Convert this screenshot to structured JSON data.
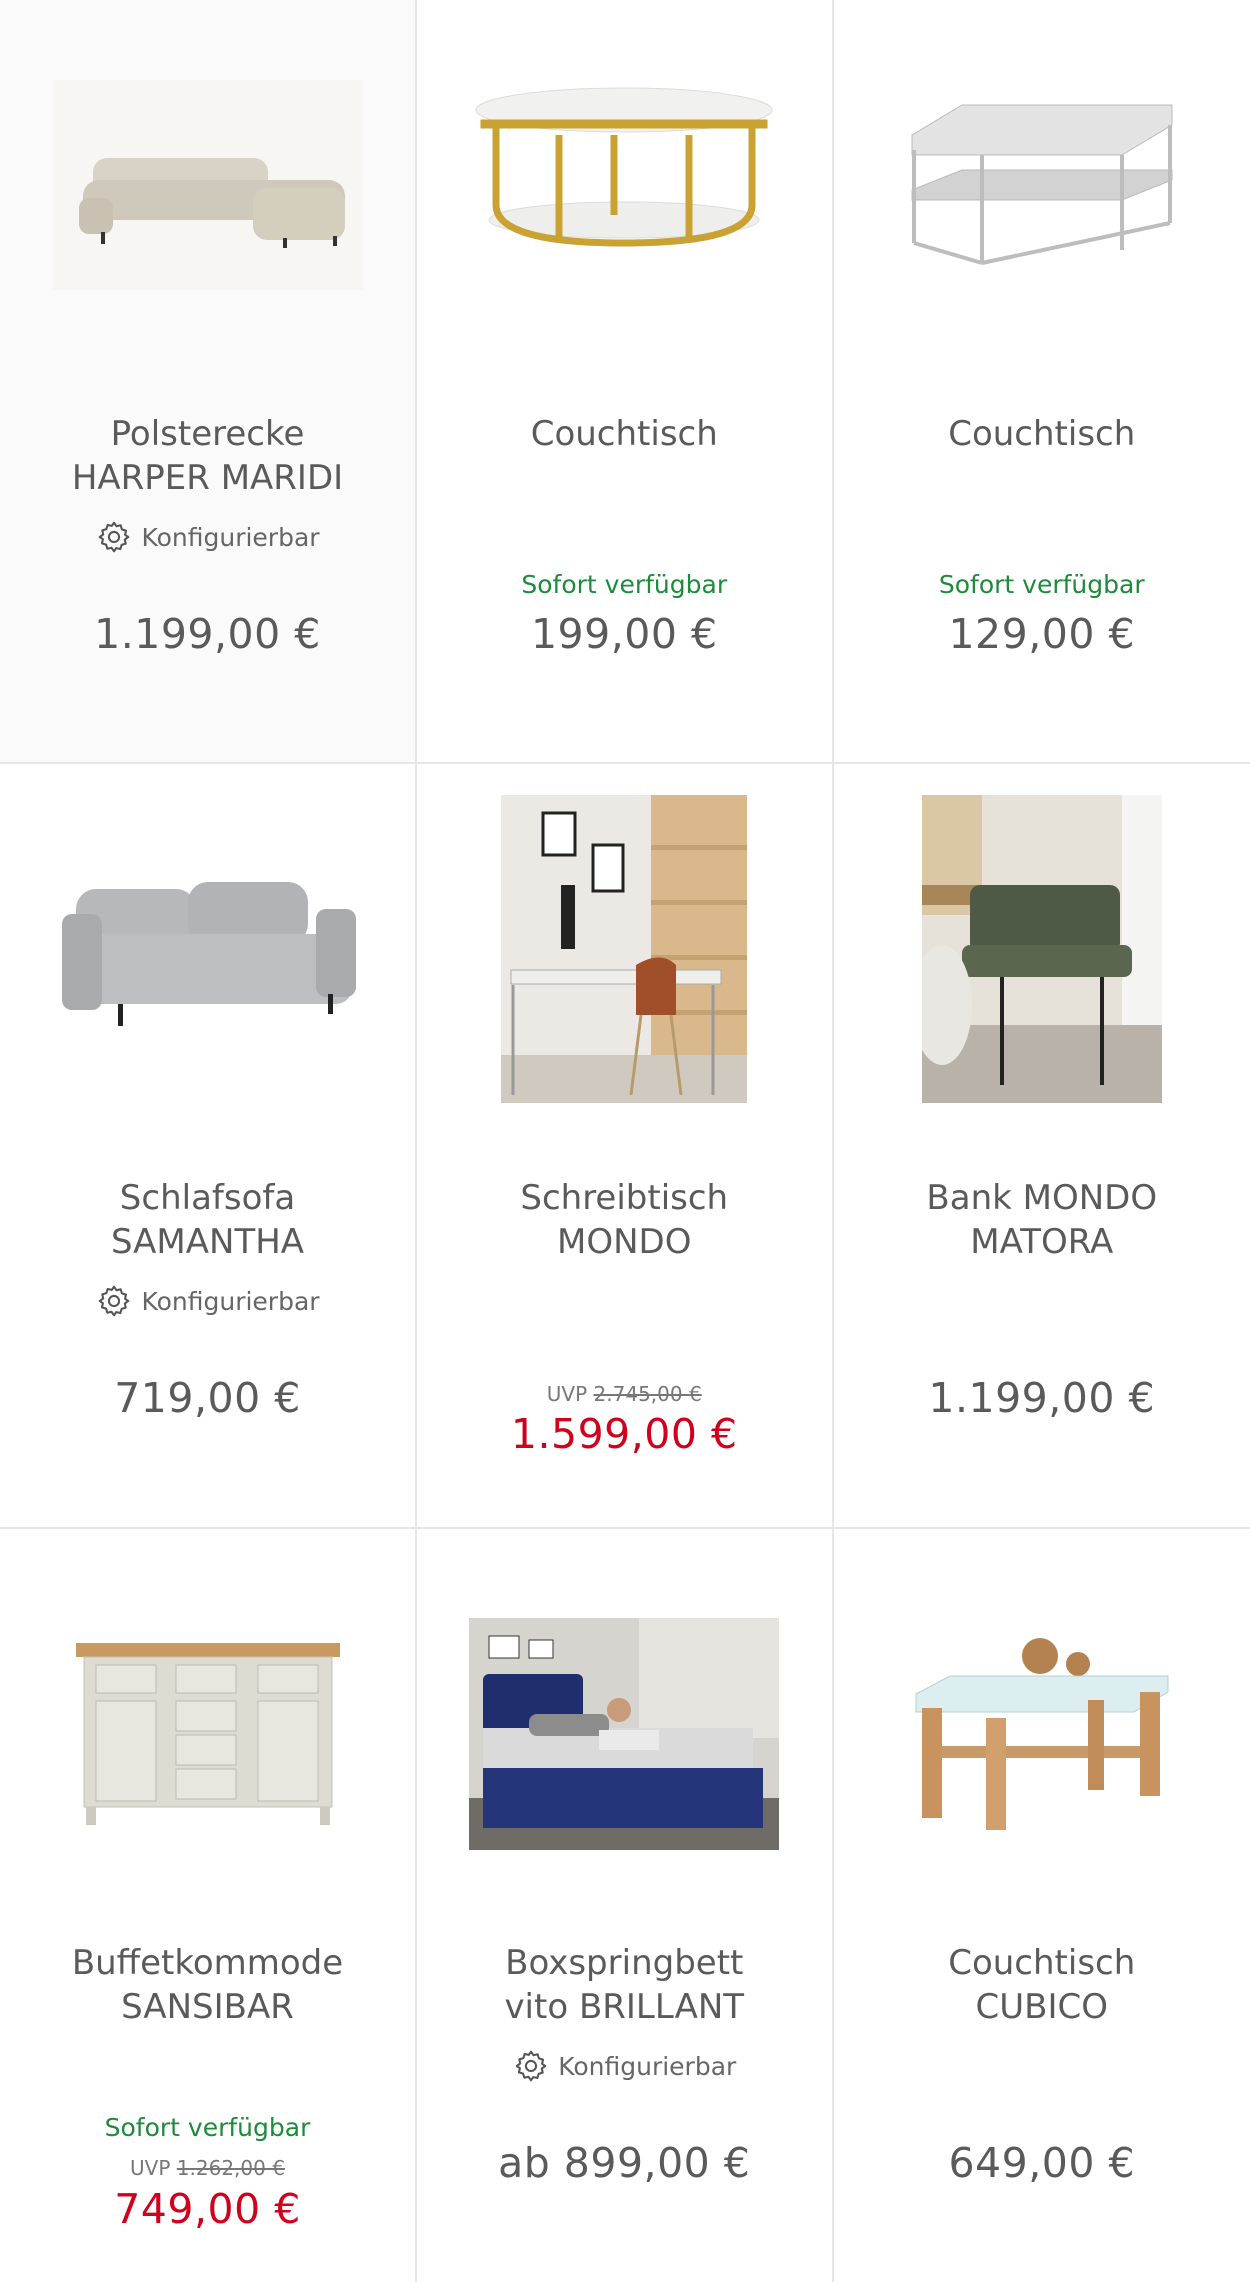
{
  "products": [
    {
      "title_lines": [
        "Polsterecke",
        "HARPER MARIDI"
      ],
      "configurable": "Konfigurierbar",
      "availability": "",
      "uvp_label": "",
      "uvp_price": "",
      "price": "1.199,00 €",
      "image": "sofa-corner-beige"
    },
    {
      "title_lines": [
        "Couchtisch",
        ""
      ],
      "configurable": "",
      "availability": "Sofort verfügbar",
      "uvp_label": "",
      "uvp_price": "",
      "price": "199,00 €",
      "image": "coffee-table-marble-gold"
    },
    {
      "title_lines": [
        "Couchtisch",
        ""
      ],
      "configurable": "",
      "availability": "Sofort verfügbar",
      "uvp_label": "",
      "uvp_price": "",
      "price": "129,00 €",
      "image": "coffee-table-grey-metal"
    },
    {
      "title_lines": [
        "Schlafsofa",
        "SAMANTHA"
      ],
      "configurable": "Konfigurierbar",
      "availability": "",
      "uvp_label": "",
      "uvp_price": "",
      "price": "719,00 €",
      "image": "sofa-grey"
    },
    {
      "title_lines": [
        "Schreibtisch",
        "MONDO"
      ],
      "configurable": "",
      "availability": "",
      "uvp_label": "UVP",
      "uvp_price": "2.745,00 €",
      "price": "1.599,00 €",
      "image": "desk-room-scene"
    },
    {
      "title_lines": [
        "Bank MONDO",
        "MATORA"
      ],
      "configurable": "",
      "availability": "",
      "uvp_label": "",
      "uvp_price": "",
      "price": "1.199,00 €",
      "image": "bench-green-scene"
    },
    {
      "title_lines": [
        "Buffetkommode",
        "SANSIBAR"
      ],
      "configurable": "",
      "availability": "Sofort verfügbar",
      "uvp_label": "UVP",
      "uvp_price": "1.262,00 €",
      "price": "749,00 €",
      "image": "sideboard-white-oak"
    },
    {
      "title_lines": [
        "Boxspringbett",
        "vito BRILLANT"
      ],
      "configurable": "Konfigurierbar",
      "availability": "",
      "uvp_label": "",
      "uvp_price": "",
      "price": "ab 899,00 €",
      "image": "boxspring-bed-blue"
    },
    {
      "title_lines": [
        "Couchtisch",
        "CUBICO"
      ],
      "configurable": "",
      "availability": "",
      "uvp_label": "",
      "uvp_price": "",
      "price": "649,00 €",
      "image": "coffee-table-glass-wood"
    }
  ],
  "colors": {
    "availability": "#1e8a3c",
    "sale_price": "#d0021b",
    "price": "#5a5a5a",
    "divider": "#e6e6e6"
  }
}
